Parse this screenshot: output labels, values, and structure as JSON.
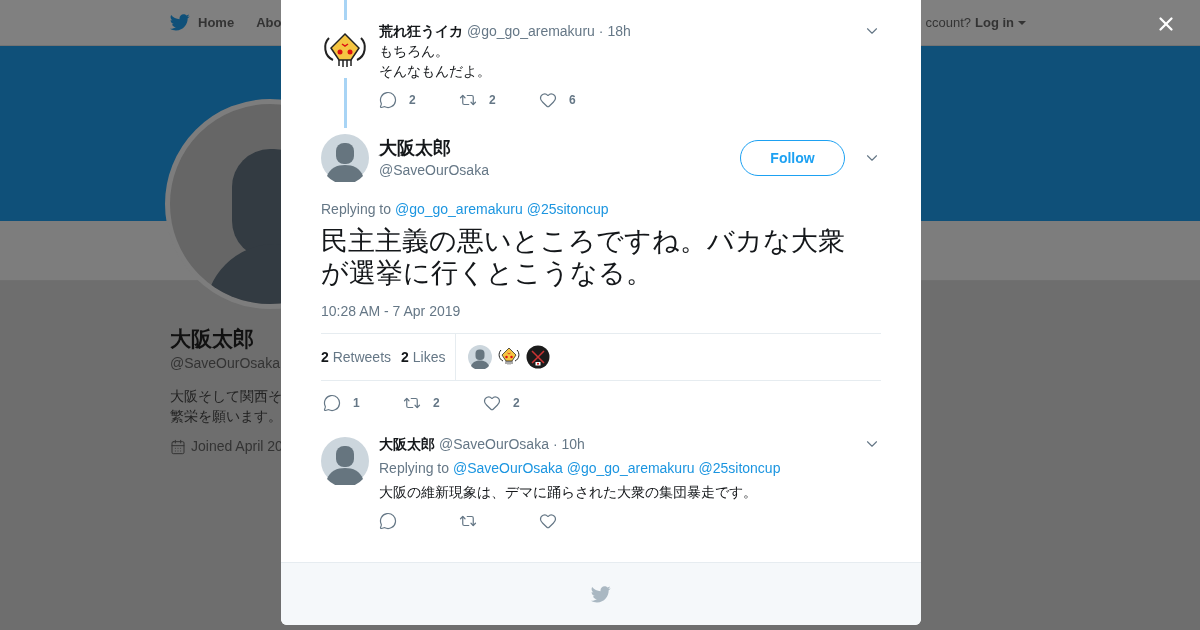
{
  "background_page": {
    "nav": {
      "items": [
        "Home",
        "Abo"
      ],
      "login_prompt": "ccount?",
      "login": "Log in"
    },
    "profile": {
      "name": "大阪太郎",
      "handle": "@SaveOurOsaka",
      "bio": [
        "大阪そして関西そ",
        "繁栄を願います。"
      ],
      "joined": "Joined April 20"
    }
  },
  "modal": {
    "parent_tweet": {
      "name": "荒れ狂うイカ",
      "handle": "@go_go_aremakuru",
      "time": "· 18h",
      "lines": [
        "もちろん。",
        "そんなもんだよ。"
      ],
      "actions": [
        {
          "kind": "reply",
          "count": "2"
        },
        {
          "kind": "retweet",
          "count": "2"
        },
        {
          "kind": "like",
          "count": "6"
        }
      ]
    },
    "main_tweet": {
      "name": "大阪太郎",
      "handle": "@SaveOurOsaka",
      "follow": "Follow",
      "replying_label": "Replying to",
      "replying_to": [
        "@go_go_aremakuru",
        "@25sitoncup"
      ],
      "text": "民主主義の悪いところですね。バカな大衆が選挙に行くとこうなる。",
      "timestamp": "10:28 AM - 7 Apr 2019",
      "stats": [
        {
          "count": "2",
          "label": "Retweets"
        },
        {
          "count": "2",
          "label": "Likes"
        }
      ],
      "actions": [
        {
          "kind": "reply",
          "count": "1"
        },
        {
          "kind": "retweet",
          "count": "2"
        },
        {
          "kind": "like",
          "count": "2"
        }
      ]
    },
    "replies": [
      {
        "name": "大阪太郎",
        "handle": "@SaveOurOsaka",
        "time": "· 10h",
        "replying_label": "Replying to",
        "replying_to": [
          "@SaveOurOsaka",
          "@go_go_aremakuru",
          "@25sitoncup"
        ],
        "text": "大阪の維新現象は、デマに踊らされた大衆の集団暴走です。",
        "actions": [
          {
            "kind": "reply"
          },
          {
            "kind": "retweet"
          },
          {
            "kind": "like"
          }
        ]
      }
    ]
  }
}
